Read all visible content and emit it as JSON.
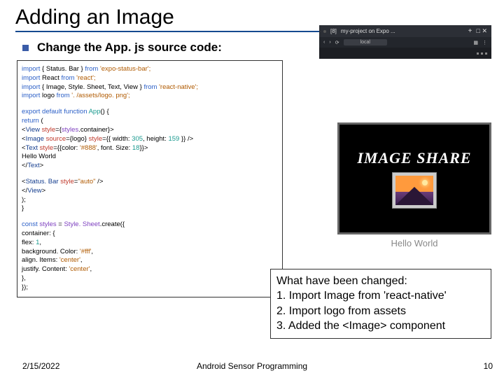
{
  "title": "Adding an Image",
  "bullet": "Change the App. js source code:",
  "code": {
    "l1a": "import",
    "l1b": " { Status. Bar } ",
    "l1c": "from",
    "l1d": " 'expo-status-bar';",
    "l2a": "import",
    "l2b": " React ",
    "l2c": "from",
    "l2d": " 'react';",
    "l3a": "import",
    "l3b": " { Image, Style. Sheet, Text, View } ",
    "l3c": "from",
    "l3d": " 'react-native';",
    "l4a": "import",
    "l4b": " logo ",
    "l4c": "from",
    "l4d": " '. /assets/logo. png';",
    "l6a": "export default function",
    "l6b": " App",
    "l6c": "() {",
    "l7a": "return",
    "l7b": " (",
    "l8a": "<",
    "l8b": "View",
    "l8c": " style",
    "l8d": "={",
    "l8e": "styles",
    "l8f": ".container}>",
    "l9a": "<",
    "l9b": "Image",
    "l9c": " source",
    "l9d": "={logo} ",
    "l9e": "style",
    "l9f": "={{ width: ",
    "l9g": "305",
    "l9h": ", height: ",
    "l9i": "159",
    "l9j": " }} />",
    "l10a": "<",
    "l10b": "Text",
    "l10c": " style",
    "l10d": "={{color: ",
    "l10e": "'#888'",
    "l10f": ", font. Size: ",
    "l10g": "18",
    "l10h": "}}>",
    "l11": "Hello World",
    "l12a": "</",
    "l12b": "Text",
    "l12c": ">",
    "l14a": "<",
    "l14b": "Status. Bar",
    "l14c": " style",
    "l14d": "=",
    "l14e": "\"auto\"",
    "l14f": " />",
    "l15a": "</",
    "l15b": "View",
    "l15c": ">",
    "l16": ");",
    "l17": "}",
    "l19a": "const",
    "l19b": " styles ",
    "l19c": "= ",
    "l19d": "Style. Sheet",
    "l19e": ".create({",
    "l20": "container: {",
    "l21a": "flex: ",
    "l21b": "1",
    "l21c": ",",
    "l22a": "background. Color: ",
    "l22b": "'#fff'",
    "l22c": ",",
    "l23a": "align. Items: ",
    "l23b": "'center'",
    "l23c": ",",
    "l24a": "justify. Content: ",
    "l24b": "'center'",
    "l24c": ",",
    "l25": "},",
    "l26": "});"
  },
  "emulator": {
    "tabPrefix": "[8]",
    "tabName": "my-project on Expo ...",
    "url": "local",
    "imgshare": "IMAGE SHARE",
    "hello": "Hello World"
  },
  "changes": {
    "heading": "What have been changed:",
    "item1": "1.  Import Image from 'react-native'",
    "item2": "2.  Import logo from assets",
    "item3": "3.  Added the <Image> component"
  },
  "footer": {
    "date": "2/15/2022",
    "center": "Android Sensor Programming",
    "page": "10"
  }
}
